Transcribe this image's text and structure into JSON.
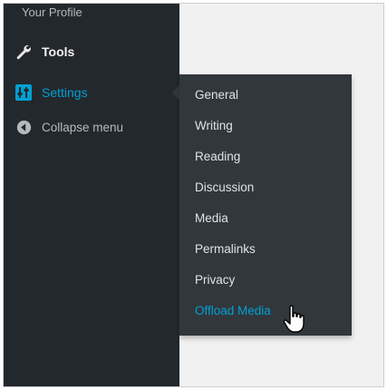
{
  "sidebar": {
    "profile_label": "Your Profile",
    "items": [
      {
        "label": "Tools",
        "icon": "wrench-icon"
      },
      {
        "label": "Settings",
        "icon": "settings-sliders-icon"
      },
      {
        "label": "Collapse menu",
        "icon": "collapse-arrow-icon"
      }
    ]
  },
  "submenu": {
    "items": [
      {
        "label": "General"
      },
      {
        "label": "Writing"
      },
      {
        "label": "Reading"
      },
      {
        "label": "Discussion"
      },
      {
        "label": "Media"
      },
      {
        "label": "Permalinks"
      },
      {
        "label": "Privacy"
      },
      {
        "label": "Offload Media"
      }
    ],
    "active_label": "Offload Media"
  },
  "colors": {
    "sidebar_bg": "#23282d",
    "submenu_bg": "#32373c",
    "accent": "#00a0d2",
    "content_bg": "#f1f1f1"
  }
}
